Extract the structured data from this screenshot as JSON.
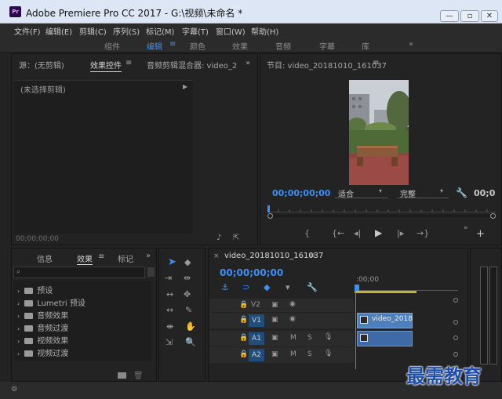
{
  "window": {
    "app_icon": "Pr",
    "title": "Adobe Premiere Pro CC 2017 - G:\\视频\\未命名 *"
  },
  "menu": [
    "文件(F)",
    "编辑(E)",
    "剪辑(C)",
    "序列(S)",
    "标记(M)",
    "字幕(T)",
    "窗口(W)",
    "帮助(H)"
  ],
  "workspaces": [
    "组件",
    "编辑",
    "颜色",
    "效果",
    "音频",
    "字幕",
    "库"
  ],
  "workspace_active": "编辑",
  "source_panel": {
    "tabs": [
      "源：(无剪辑)",
      "效果控件",
      "音频剪辑混合器: video_2"
    ],
    "content": "(未选择剪辑)",
    "timecode": "00;00;00;00"
  },
  "program_panel": {
    "title": "节目: video_20181010_161037",
    "timecode": "00;00;00;00",
    "zoom": "适合",
    "quality": "完整",
    "duration": "00;0"
  },
  "project_panel": {
    "tabs": [
      "信息",
      "效果",
      "标记"
    ],
    "search_placeholder": "",
    "items": [
      "预设",
      "Lumetri 预设",
      "音频效果",
      "音频过渡",
      "视频效果",
      "视频过渡"
    ]
  },
  "timeline": {
    "tab": "video_20181010_161037",
    "timecode": "00;00;00;00",
    "ruler_label": ":00;00",
    "tracks": [
      {
        "name": "V2",
        "type": "video"
      },
      {
        "name": "V1",
        "type": "video"
      },
      {
        "name": "A1",
        "type": "audio"
      },
      {
        "name": "A2",
        "type": "audio"
      }
    ],
    "clip_label": "video_2018",
    "mute": "M",
    "solo": "S"
  },
  "watermark": "最需教育",
  "colors": {
    "accent": "#3d8ff5",
    "clip_video": "#4c7fbe",
    "clip_audio": "#3e6aa8"
  }
}
